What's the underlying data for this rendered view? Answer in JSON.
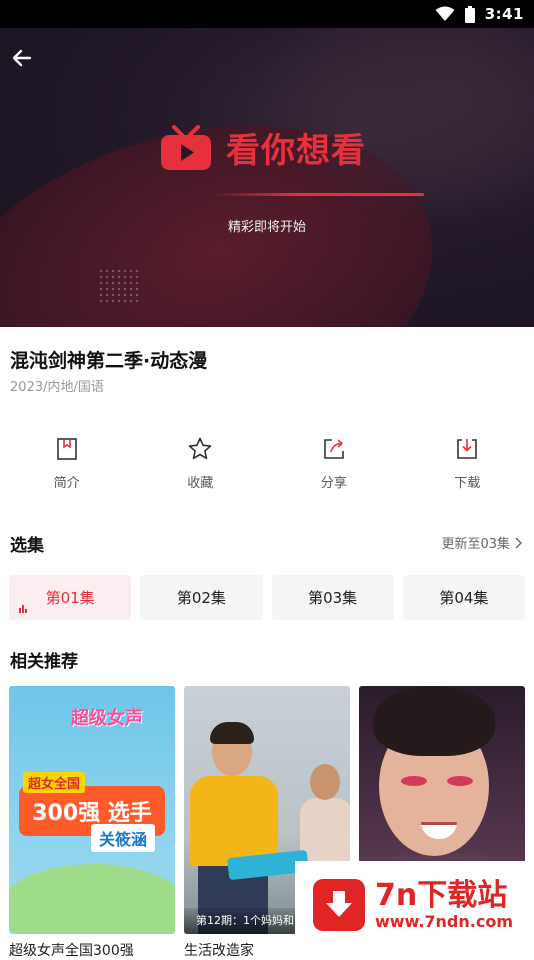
{
  "status_bar": {
    "time": "3:41"
  },
  "player": {
    "logo_text": "看你想看",
    "loading_text": "精彩即将开始"
  },
  "video": {
    "title": "混沌剑神第二季·动态漫",
    "meta": "2023/内地/国语"
  },
  "actions": [
    {
      "label": "简介",
      "icon": "bookmark-icon"
    },
    {
      "label": "收藏",
      "icon": "star-icon"
    },
    {
      "label": "分享",
      "icon": "share-icon"
    },
    {
      "label": "下载",
      "icon": "download-icon"
    }
  ],
  "episodes_section": {
    "title": "选集",
    "update_text": "更新至03集",
    "episodes": [
      "第01集",
      "第02集",
      "第03集",
      "第04集"
    ],
    "active_index": 0
  },
  "recommend_section": {
    "title": "相关推荐",
    "items": [
      {
        "title": "超级女声全国300强",
        "thumb_texts": {
          "brand": "超级女声",
          "top": "超女全国",
          "badge": "300强 选手",
          "name": "关筱涵"
        }
      },
      {
        "title": "生活改造家",
        "caption": "第12期：1个妈妈和"
      },
      {
        "title": ""
      }
    ]
  },
  "watermark": {
    "name": "7n下载站",
    "url": "www.7ndn.com"
  },
  "colors": {
    "accent": "#e6313d",
    "watermark_red": "#e12424"
  }
}
